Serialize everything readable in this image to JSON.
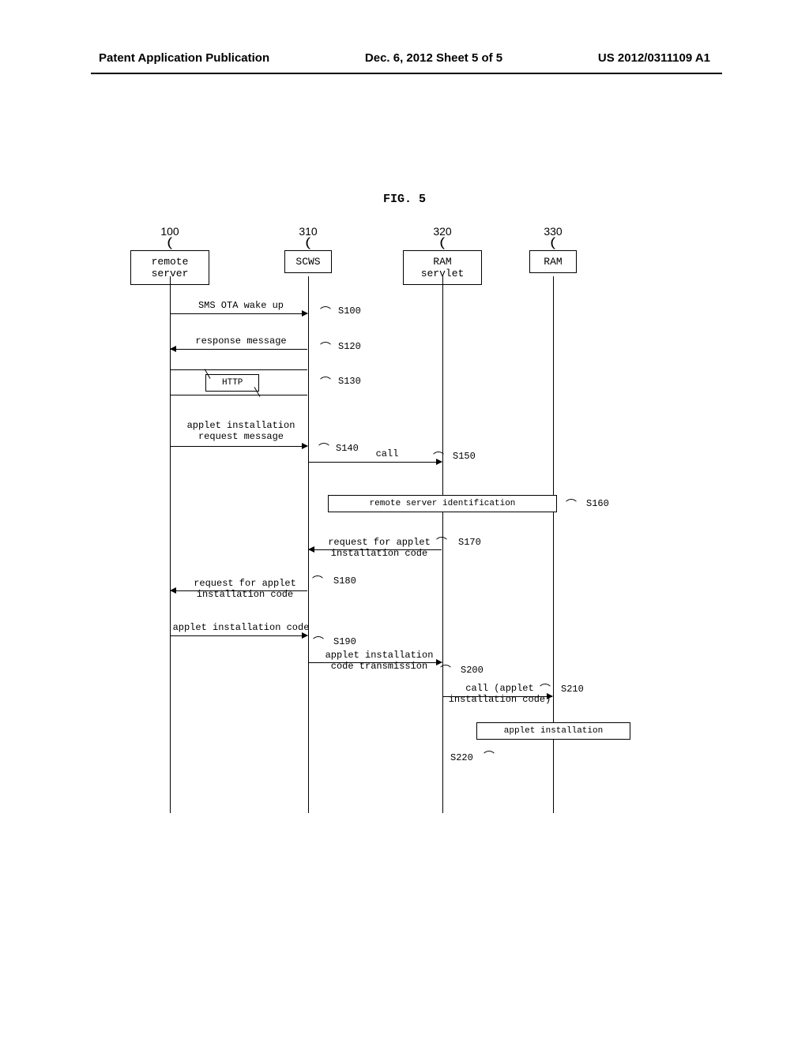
{
  "header": {
    "left": "Patent Application Publication",
    "center": "Dec. 6, 2012  Sheet 5 of 5",
    "right": "US 2012/0311109 A1"
  },
  "title": "FIG. 5",
  "lifelines": [
    {
      "ref": "100",
      "label": "remote server"
    },
    {
      "ref": "310",
      "label": "SCWS"
    },
    {
      "ref": "320",
      "label": "RAM servlet"
    },
    {
      "ref": "330",
      "label": "RAM"
    }
  ],
  "messages": {
    "s100": {
      "label": "SMS OTA wake up",
      "step": "S100"
    },
    "s120": {
      "label": "response message",
      "step": "S120"
    },
    "s130": {
      "label": "HTTP",
      "step": "S130"
    },
    "s140": {
      "label": "applet installation\nrequest message",
      "step": "S140"
    },
    "s150": {
      "label": "call",
      "step": "S150"
    },
    "s160": {
      "label": "remote server identification",
      "step": "S160"
    },
    "s170": {
      "label": "request for applet\ninstallation code",
      "step": "S170"
    },
    "s180": {
      "label": "request for applet\ninstallation code",
      "step": "S180"
    },
    "s190": {
      "label": "applet installation code",
      "step": "S190"
    },
    "s200": {
      "label": "applet installation\ncode transmission",
      "step": "S200"
    },
    "s210": {
      "label": "call (applet\ninstallation code)",
      "step": "S210"
    },
    "s220": {
      "label": "applet installation",
      "step": "S220"
    }
  }
}
